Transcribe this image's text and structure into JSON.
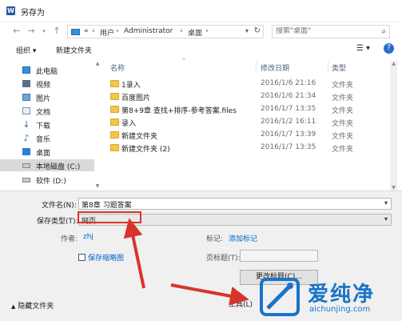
{
  "window": {
    "title": "另存为",
    "app_icon_letter": "W"
  },
  "address": {
    "overflow": "«",
    "crumbs": [
      "用户",
      "Administrator",
      "桌面"
    ],
    "separator": "›"
  },
  "search": {
    "placeholder": "搜索\"桌面\""
  },
  "toolbar": {
    "organize_label": "组织 ▾",
    "new_folder_label": "新建文件夹"
  },
  "nav": {
    "items": [
      {
        "label": "此电脑",
        "icon": "pc-icon"
      },
      {
        "label": "视频",
        "icon": "video-icon"
      },
      {
        "label": "图片",
        "icon": "picture-icon"
      },
      {
        "label": "文档",
        "icon": "document-icon"
      },
      {
        "label": "下载",
        "icon": "download-icon"
      },
      {
        "label": "音乐",
        "icon": "music-icon"
      },
      {
        "label": "桌面",
        "icon": "desktop-icon"
      },
      {
        "label": "本地磁盘 (C:)",
        "icon": "drive-icon"
      },
      {
        "label": "软件 (D:)",
        "icon": "drive-icon"
      }
    ]
  },
  "columns": {
    "name": "名称",
    "date": "修改日期",
    "type": "类型"
  },
  "files": [
    {
      "name": "1录入",
      "date": "2016/1/6 21:16",
      "type": "文件夹"
    },
    {
      "name": "百度图片",
      "date": "2016/1/6 21:34",
      "type": "文件夹"
    },
    {
      "name": "第8+9章 查找+排序-参考答案.files",
      "date": "2016/1/7 13:35",
      "type": "文件夹"
    },
    {
      "name": "录入",
      "date": "2016/1/2 16:11",
      "type": "文件夹"
    },
    {
      "name": "新建文件夹",
      "date": "2016/1/7 13:39",
      "type": "文件夹"
    },
    {
      "name": "新建文件夹 (2)",
      "date": "2016/1/7 13:35",
      "type": "文件夹"
    }
  ],
  "form": {
    "filename_label": "文件名(N):",
    "filename_value": "第8章 习题答案",
    "savetype_label": "保存类型(T):",
    "savetype_value": "网页",
    "author_label": "作者:",
    "author_value": "zhj",
    "tags_label": "标记:",
    "tags_value": "添加标记",
    "thumbnail_label": "保存缩略图",
    "page_title_label": "页标题(T):",
    "change_title_label": "更改标题(C)...",
    "hide_folders_label": "隐藏文件夹",
    "tools_label": "工具(L)"
  },
  "watermark": {
    "text": "爱纯净",
    "url": "aichunjing.com"
  },
  "colors": {
    "accent": "#0066cc",
    "annotation": "#d8342b",
    "folder": "#f4c64a",
    "watermark": "#1a73c8"
  }
}
